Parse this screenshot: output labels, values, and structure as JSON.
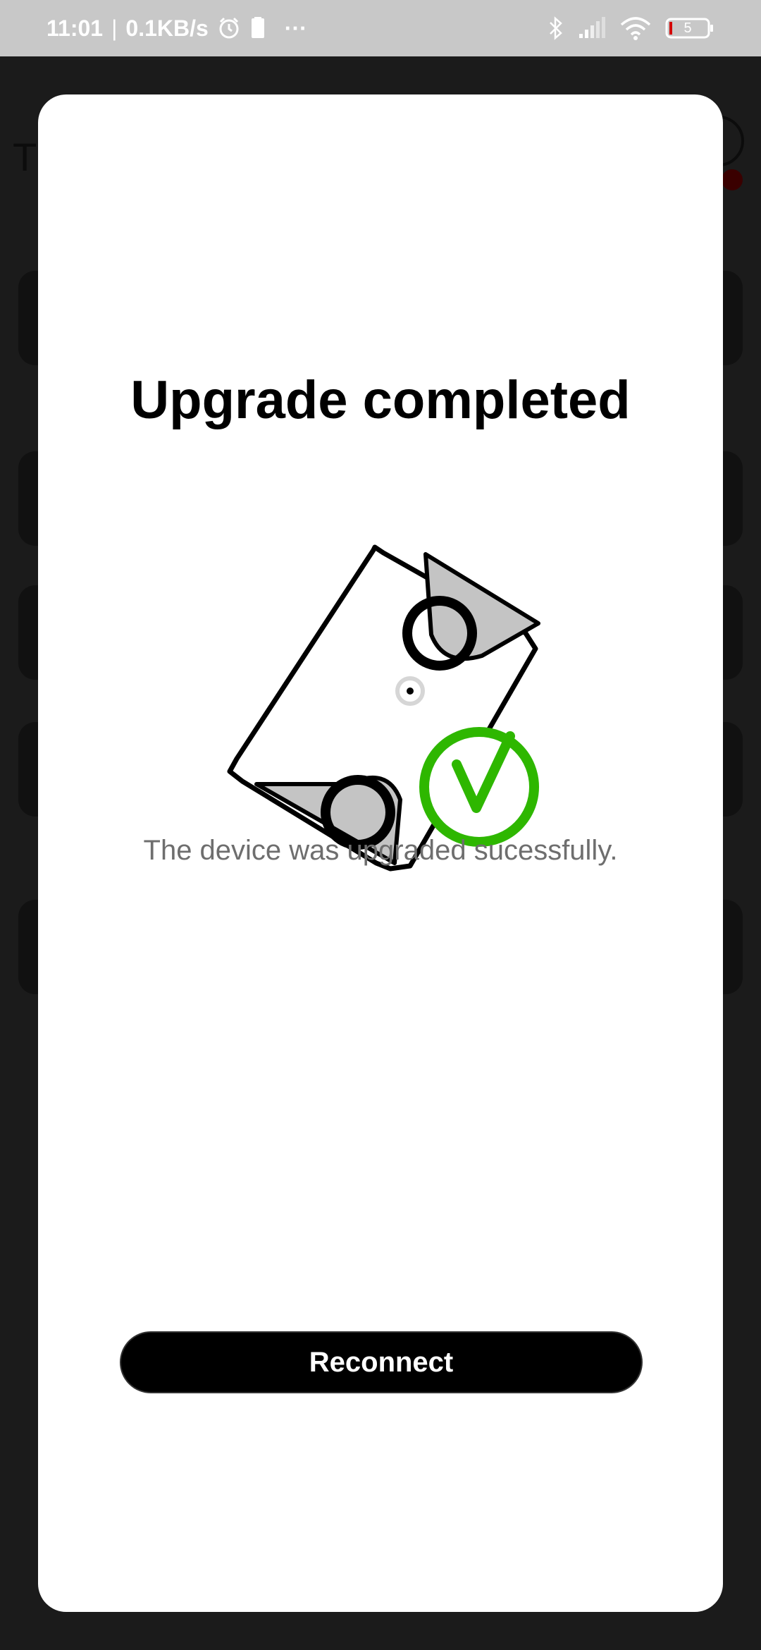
{
  "status_bar": {
    "time": "11:01",
    "network_speed": "0.1KB/s",
    "separator": "|",
    "more": "···",
    "battery_level": "5",
    "icons": [
      "alarm-icon",
      "sim-card-icon",
      "bluetooth-icon",
      "signal-icon",
      "wifi-icon",
      "battery-icon"
    ]
  },
  "background_app": {
    "title_initial": "T",
    "accent_dot_color": "#3a0000"
  },
  "modal": {
    "title": "Upgrade completed",
    "message": "The device was upgraded sucessfully.",
    "reconnect_label": "Reconnect",
    "illustration": "device-upgraded-illustration",
    "check_color": "#2eb700"
  }
}
